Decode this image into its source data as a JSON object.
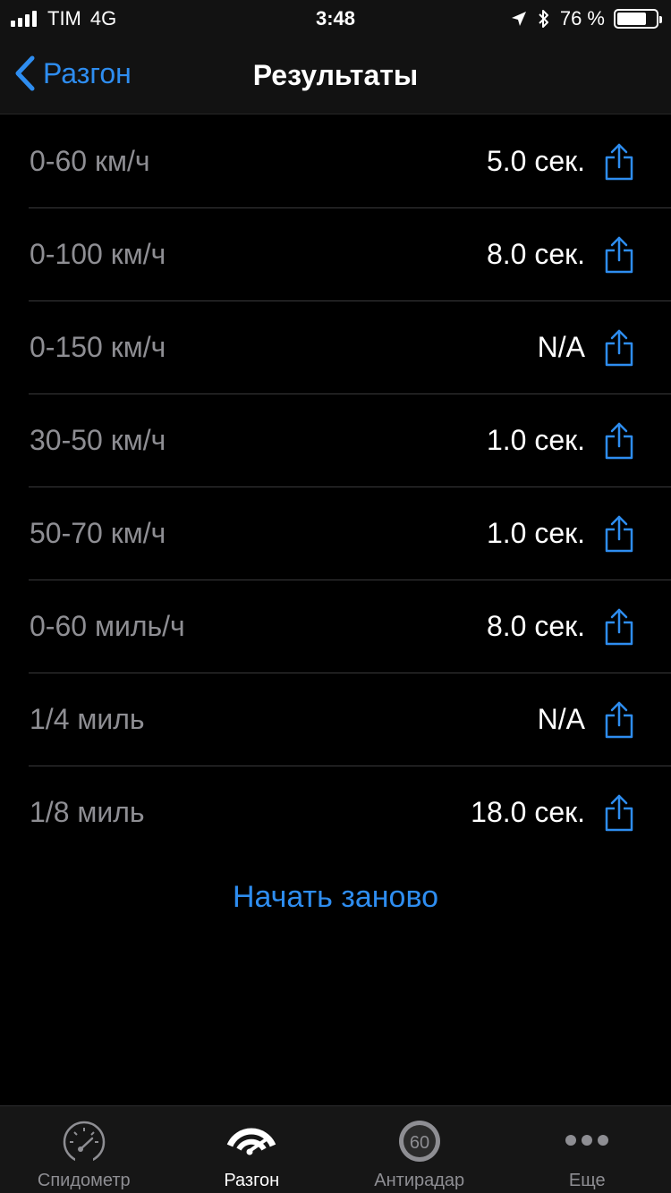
{
  "status_bar": {
    "carrier": "TIM",
    "network": "4G",
    "time": "3:48",
    "battery_text": "76 %",
    "battery_level": 0.76
  },
  "nav": {
    "back_label": "Разгон",
    "title": "Результаты"
  },
  "results": [
    {
      "label": "0-60 км/ч",
      "value": "5.0 сек."
    },
    {
      "label": "0-100 км/ч",
      "value": "8.0 сек."
    },
    {
      "label": "0-150 км/ч",
      "value": "N/A"
    },
    {
      "label": "30-50 км/ч",
      "value": "1.0 сек."
    },
    {
      "label": "50-70 км/ч",
      "value": "1.0 сек."
    },
    {
      "label": "0-60 миль/ч",
      "value": "8.0 сек."
    },
    {
      "label": "1/4 миль",
      "value": "N/A"
    },
    {
      "label": "1/8 миль",
      "value": "18.0 сек."
    }
  ],
  "restart_label": "Начать заново",
  "tabs": [
    {
      "label": "Спидометр",
      "icon": "speedometer-icon",
      "active": false
    },
    {
      "label": "Разгон",
      "icon": "acceleration-icon",
      "active": true
    },
    {
      "label": "Антирадар",
      "icon": "speed-limit-60-icon",
      "icon_text": "60",
      "active": false
    },
    {
      "label": "Еще",
      "icon": "more-icon",
      "active": false
    }
  ],
  "colors": {
    "accent": "#2e8df0",
    "background": "#000000",
    "bar_background": "#121212",
    "secondary_text": "#8e8e93",
    "separator": "#3a3a3c"
  }
}
